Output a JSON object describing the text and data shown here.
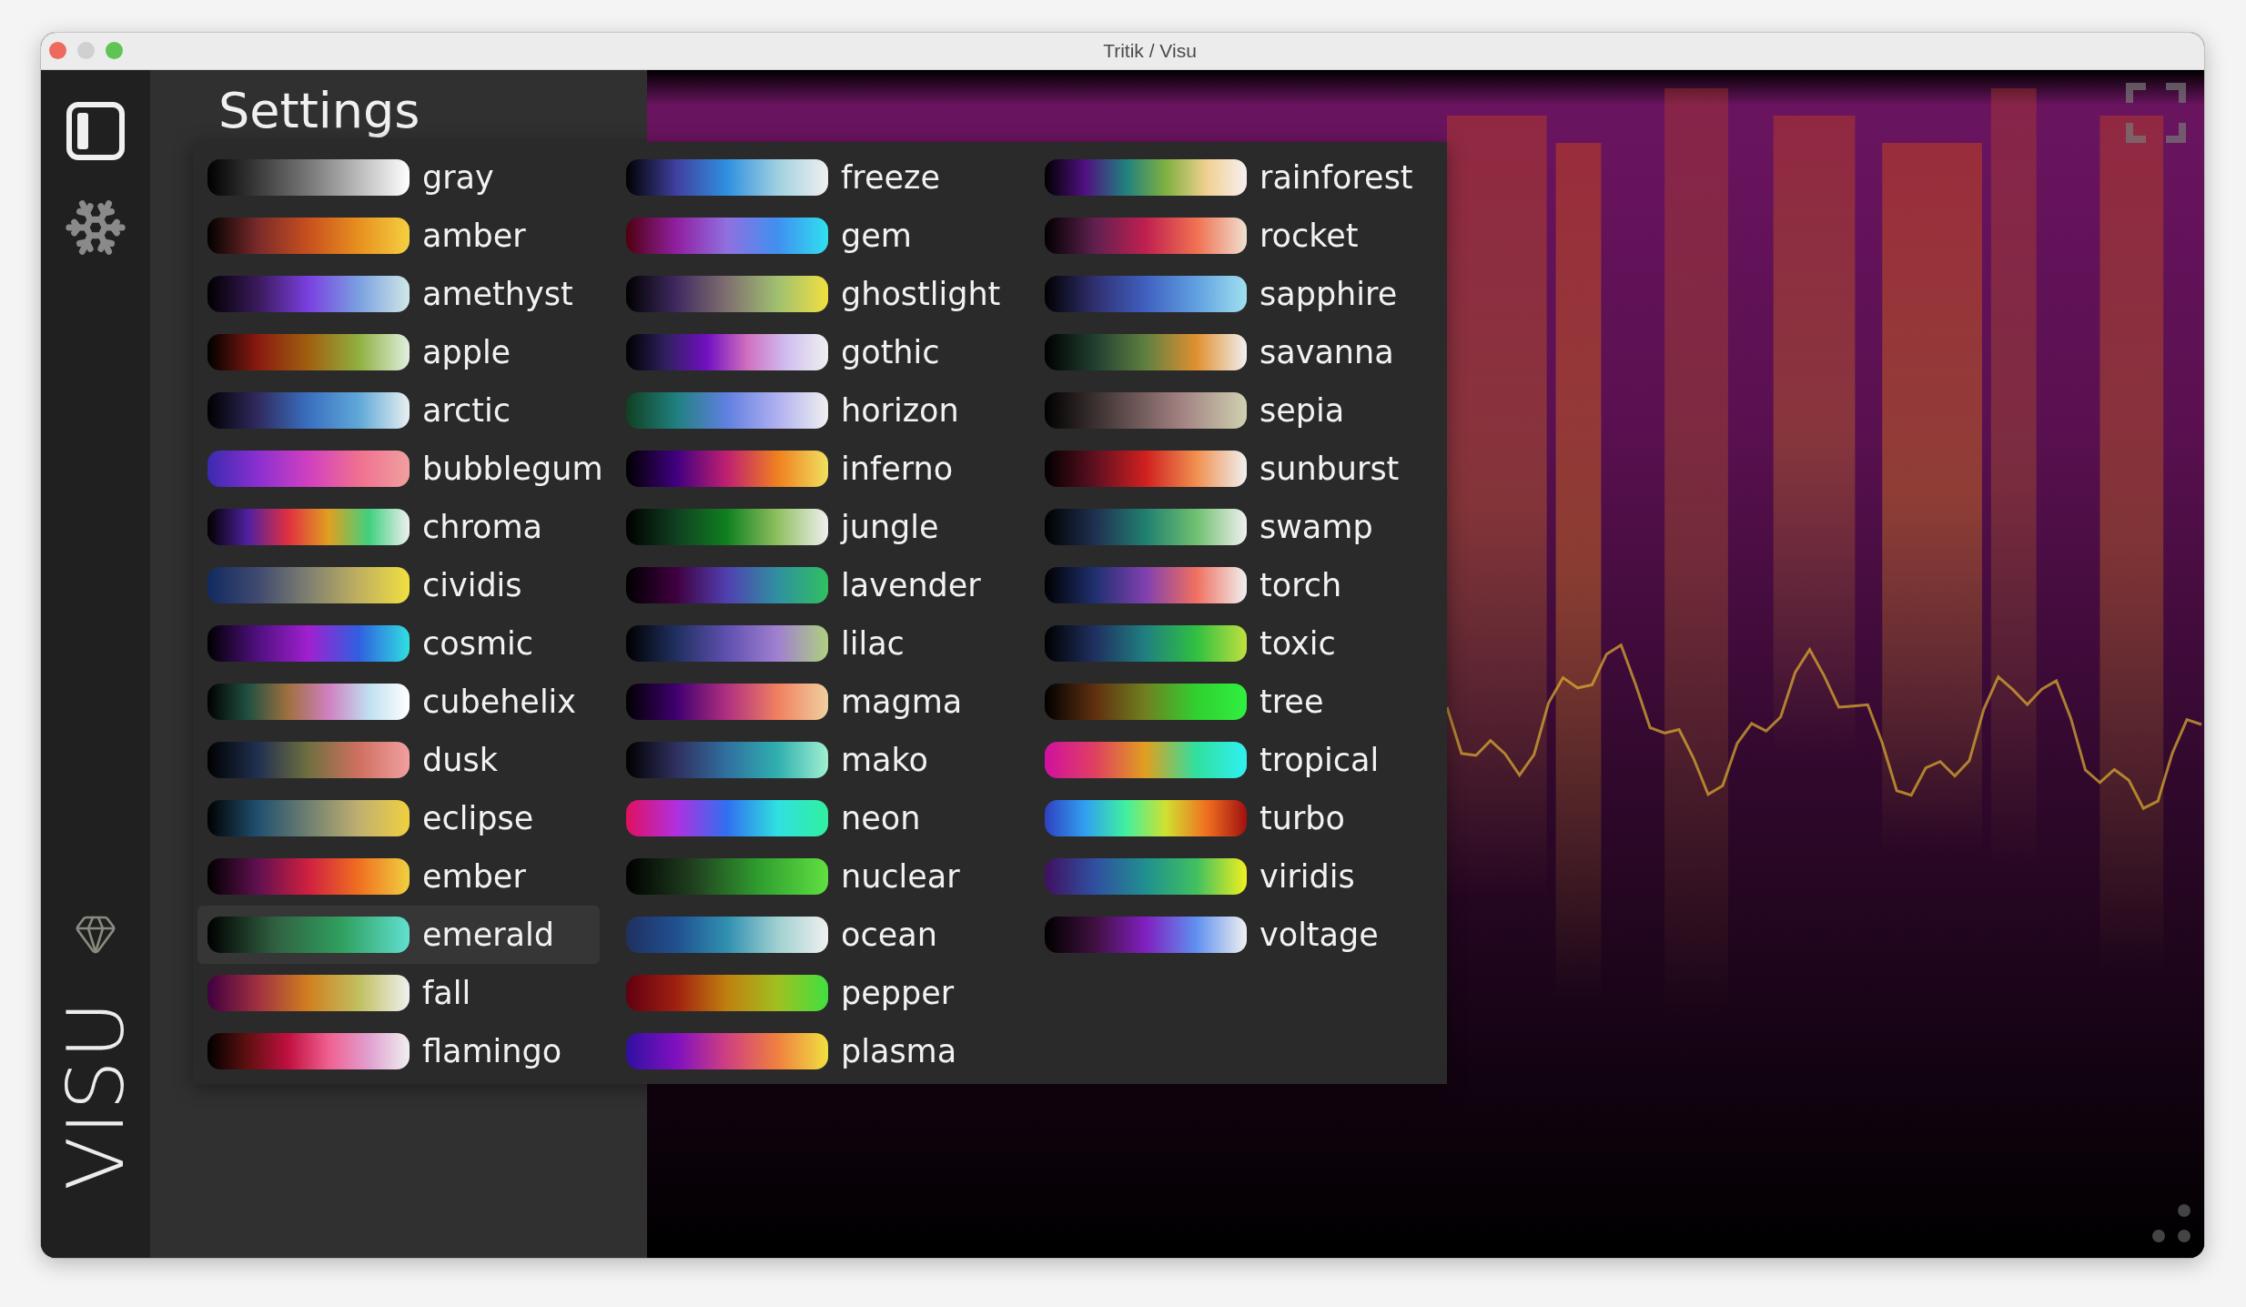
{
  "window": {
    "title": "Tritik / Visu"
  },
  "sidebar": {
    "logo": "VISU"
  },
  "settings": {
    "title": "Settings"
  },
  "colormap_menu": {
    "items": [
      {
        "label": "gray",
        "selected": false
      },
      {
        "label": "amber",
        "selected": false
      },
      {
        "label": "amethyst",
        "selected": false
      },
      {
        "label": "apple",
        "selected": false
      },
      {
        "label": "arctic",
        "selected": false
      },
      {
        "label": "bubblegum",
        "selected": false
      },
      {
        "label": "chroma",
        "selected": false
      },
      {
        "label": "cividis",
        "selected": false
      },
      {
        "label": "cosmic",
        "selected": false
      },
      {
        "label": "cubehelix",
        "selected": false
      },
      {
        "label": "dusk",
        "selected": false
      },
      {
        "label": "eclipse",
        "selected": false
      },
      {
        "label": "ember",
        "selected": false
      },
      {
        "label": "emerald",
        "selected": true
      },
      {
        "label": "fall",
        "selected": false
      },
      {
        "label": "flamingo",
        "selected": false
      },
      {
        "label": "freeze",
        "selected": false
      },
      {
        "label": "gem",
        "selected": false
      },
      {
        "label": "ghostlight",
        "selected": false
      },
      {
        "label": "gothic",
        "selected": false
      },
      {
        "label": "horizon",
        "selected": false
      },
      {
        "label": "inferno",
        "selected": false
      },
      {
        "label": "jungle",
        "selected": false
      },
      {
        "label": "lavender",
        "selected": false
      },
      {
        "label": "lilac",
        "selected": false
      },
      {
        "label": "magma",
        "selected": false
      },
      {
        "label": "mako",
        "selected": false
      },
      {
        "label": "neon",
        "selected": false
      },
      {
        "label": "nuclear",
        "selected": false
      },
      {
        "label": "ocean",
        "selected": false
      },
      {
        "label": "pepper",
        "selected": false
      },
      {
        "label": "plasma",
        "selected": false
      },
      {
        "label": "rainforest",
        "selected": false
      },
      {
        "label": "rocket",
        "selected": false
      },
      {
        "label": "sapphire",
        "selected": false
      },
      {
        "label": "savanna",
        "selected": false
      },
      {
        "label": "sepia",
        "selected": false
      },
      {
        "label": "sunburst",
        "selected": false
      },
      {
        "label": "swamp",
        "selected": false
      },
      {
        "label": "torch",
        "selected": false
      },
      {
        "label": "toxic",
        "selected": false
      },
      {
        "label": "tree",
        "selected": false
      },
      {
        "label": "tropical",
        "selected": false
      },
      {
        "label": "turbo",
        "selected": false
      },
      {
        "label": "viridis",
        "selected": false
      },
      {
        "label": "voltage",
        "selected": false
      }
    ]
  }
}
